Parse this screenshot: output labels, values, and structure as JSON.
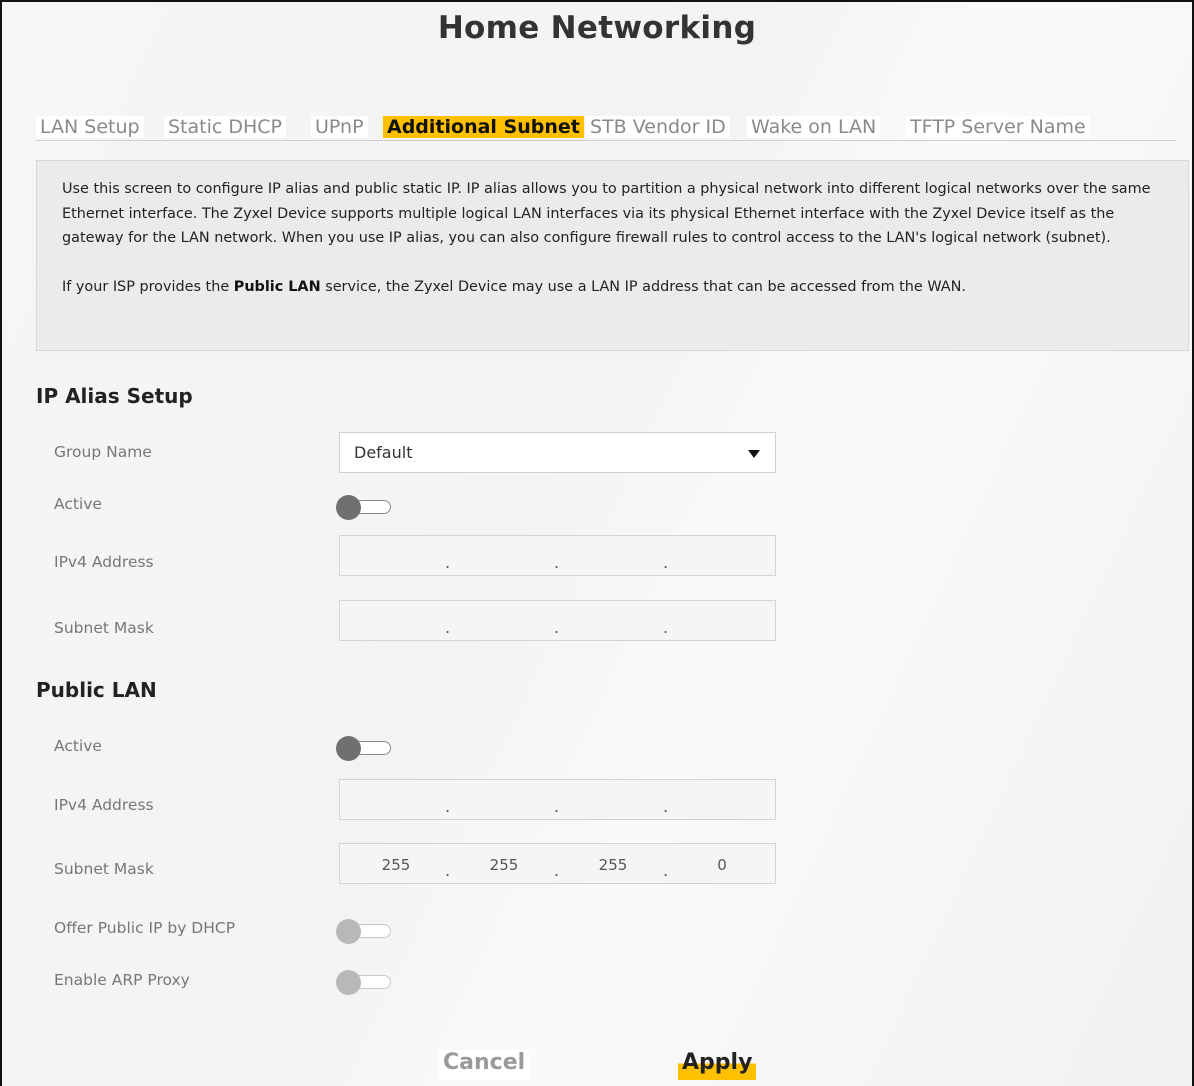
{
  "page": {
    "title": "Home Networking"
  },
  "tabs": [
    {
      "label": "LAN Setup",
      "active": false
    },
    {
      "label": "Static DHCP",
      "active": false
    },
    {
      "label": "UPnP",
      "active": false
    },
    {
      "label": "Additional Subnet",
      "active": true
    },
    {
      "label": "STB Vendor ID",
      "active": false
    },
    {
      "label": "Wake on LAN",
      "active": false
    },
    {
      "label": "TFTP Server Name",
      "active": false
    }
  ],
  "info": {
    "paragraph1": "Use this screen to configure IP alias and public static IP. IP alias allows you to partition a physical network into different logical networks over the same Ethernet interface. The Zyxel Device supports multiple logical LAN interfaces via its physical Ethernet interface with the Zyxel Device itself as the gateway for the LAN network. When you use IP alias, you can also configure firewall rules to control access to the LAN's logical network (subnet).",
    "paragraph2_before": "If your ISP provides the ",
    "paragraph2_bold": "Public LAN",
    "paragraph2_after": " service, the Zyxel Device may use a LAN IP address that can be accessed from the WAN."
  },
  "ip_alias": {
    "heading": "IP Alias Setup",
    "group_name_label": "Group Name",
    "group_name_value": "Default",
    "active_label": "Active",
    "active_on": false,
    "ipv4_label": "IPv4 Address",
    "ipv4_octets": [
      "",
      "",
      "",
      ""
    ],
    "mask_label": "Subnet Mask",
    "mask_octets": [
      "",
      "",
      "",
      ""
    ]
  },
  "public_lan": {
    "heading": "Public LAN",
    "active_label": "Active",
    "active_on": false,
    "ipv4_label": "IPv4 Address",
    "ipv4_octets": [
      "",
      "",
      "",
      ""
    ],
    "mask_label": "Subnet Mask",
    "mask_octets": [
      "255",
      "255",
      "255",
      "0"
    ],
    "offer_dhcp_label": "Offer Public IP by DHCP",
    "offer_dhcp_on": false,
    "arp_proxy_label": "Enable ARP Proxy",
    "arp_proxy_on": false
  },
  "buttons": {
    "cancel": "Cancel",
    "apply": "Apply"
  },
  "colors": {
    "accent": "#ffc000",
    "info_bg": "#ebebeb"
  },
  "icons": {
    "dropdown": "caret-down-icon"
  }
}
